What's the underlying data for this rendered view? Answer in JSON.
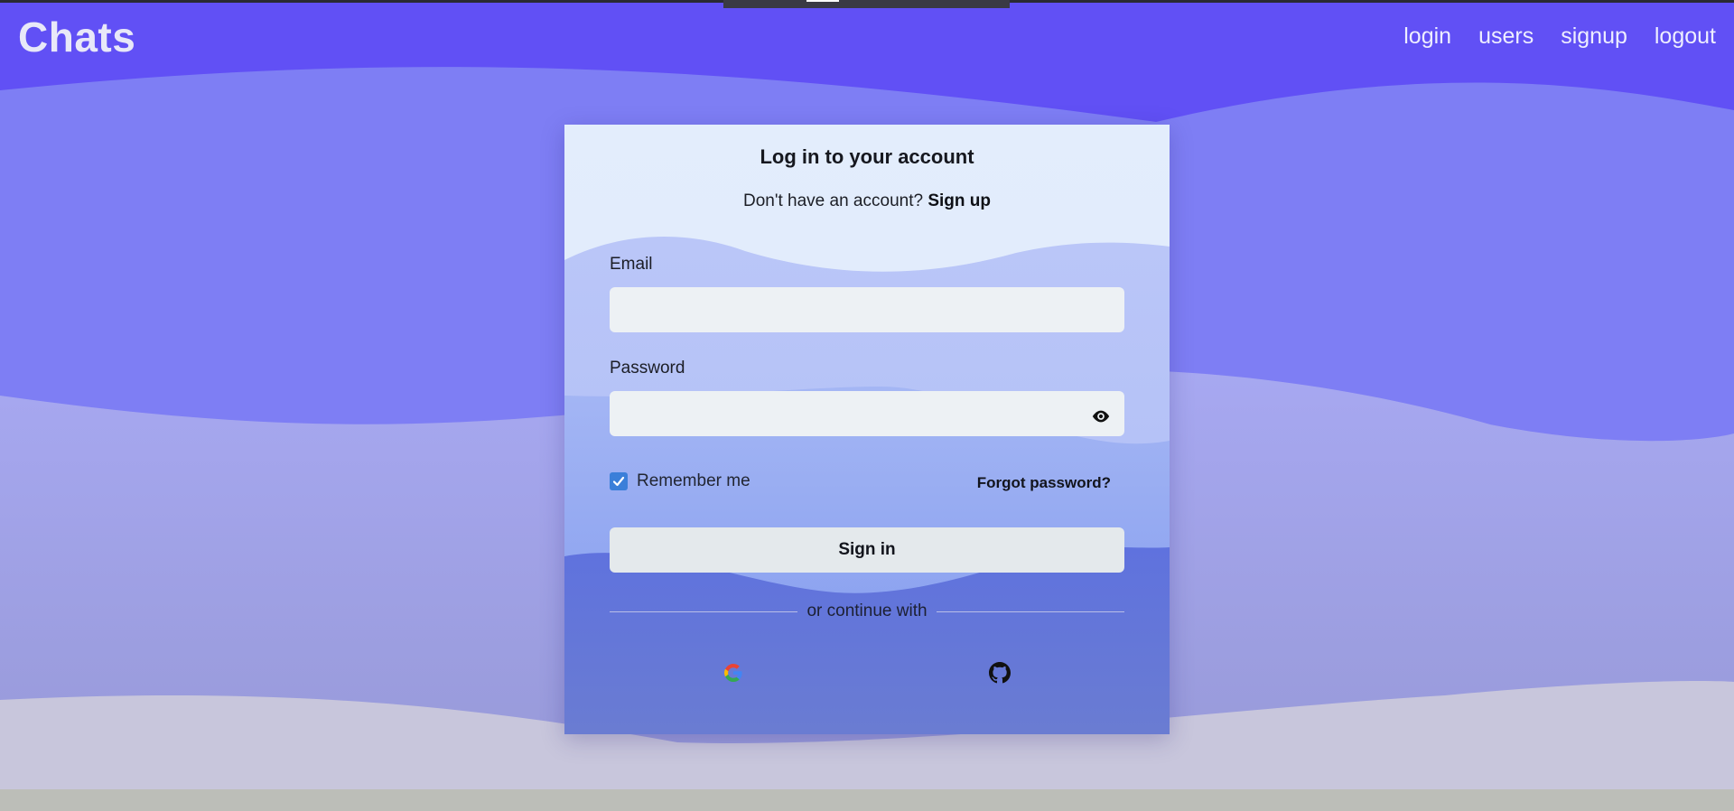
{
  "header": {
    "brand": "Chats",
    "nav": [
      "login",
      "users",
      "signup",
      "logout"
    ]
  },
  "login_form": {
    "title": "Log in to your account",
    "no_account_text": "Don't have an account?",
    "signup_link": "Sign up",
    "email_label": "Email",
    "email_value": "",
    "password_label": "Password",
    "password_value": "",
    "remember_label": "Remember me",
    "remember_checked": true,
    "forgot_link": "Forgot password?",
    "signin_button": "Sign in",
    "divider_text": "or continue with",
    "social_icons": [
      "google-icon",
      "github-icon"
    ]
  },
  "colors": {
    "header_wave": "#6150f5",
    "body_wave": "#7e7ef4",
    "light_wave": "#a7a8f0",
    "bottom_wave": "#c8c6dc",
    "card_top": "#e2edfb",
    "card_wave": "#bcc8f8",
    "card_bottom_wave": "#6377db",
    "checkbox": "#3b7fd9"
  }
}
